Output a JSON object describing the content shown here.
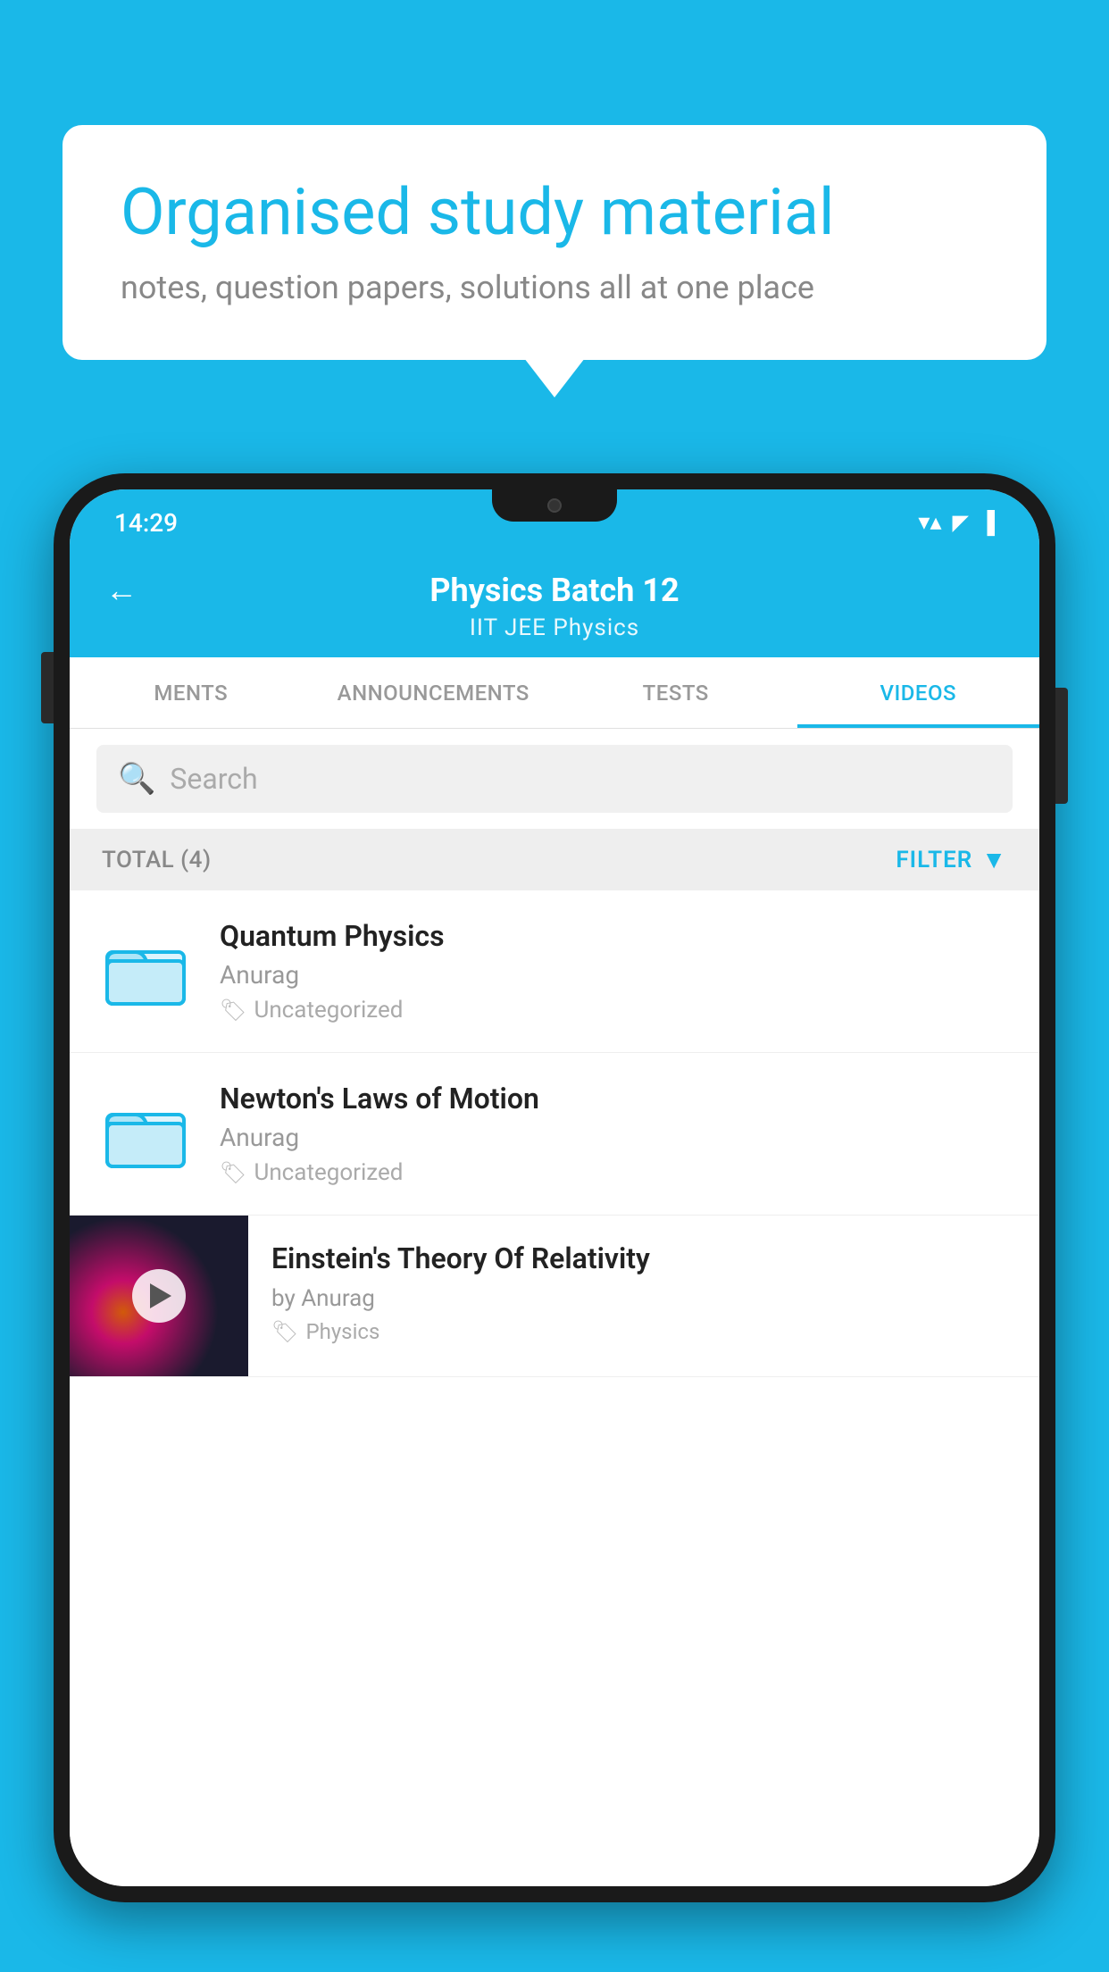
{
  "background_color": "#1ab8e8",
  "speech_bubble": {
    "title": "Organised study material",
    "subtitle": "notes, question papers, solutions all at one place"
  },
  "phone": {
    "status_bar": {
      "time": "14:29",
      "wifi": "▼▲",
      "battery": "▮"
    },
    "header": {
      "back_label": "←",
      "title": "Physics Batch 12",
      "subtitle": "IIT JEE   Physics"
    },
    "tabs": [
      {
        "label": "MENTS",
        "active": false
      },
      {
        "label": "ANNOUNCEMENTS",
        "active": false
      },
      {
        "label": "TESTS",
        "active": false
      },
      {
        "label": "VIDEOS",
        "active": true
      }
    ],
    "search": {
      "placeholder": "Search"
    },
    "filter_bar": {
      "total_label": "TOTAL (4)",
      "filter_label": "FILTER"
    },
    "videos": [
      {
        "id": "quantum",
        "title": "Quantum Physics",
        "author": "Anurag",
        "tag": "Uncategorized",
        "has_thumb": false
      },
      {
        "id": "newton",
        "title": "Newton's Laws of Motion",
        "author": "Anurag",
        "tag": "Uncategorized",
        "has_thumb": false
      },
      {
        "id": "einstein",
        "title": "Einstein's Theory Of Relativity",
        "author": "by Anurag",
        "tag": "Physics",
        "has_thumb": true
      }
    ]
  }
}
